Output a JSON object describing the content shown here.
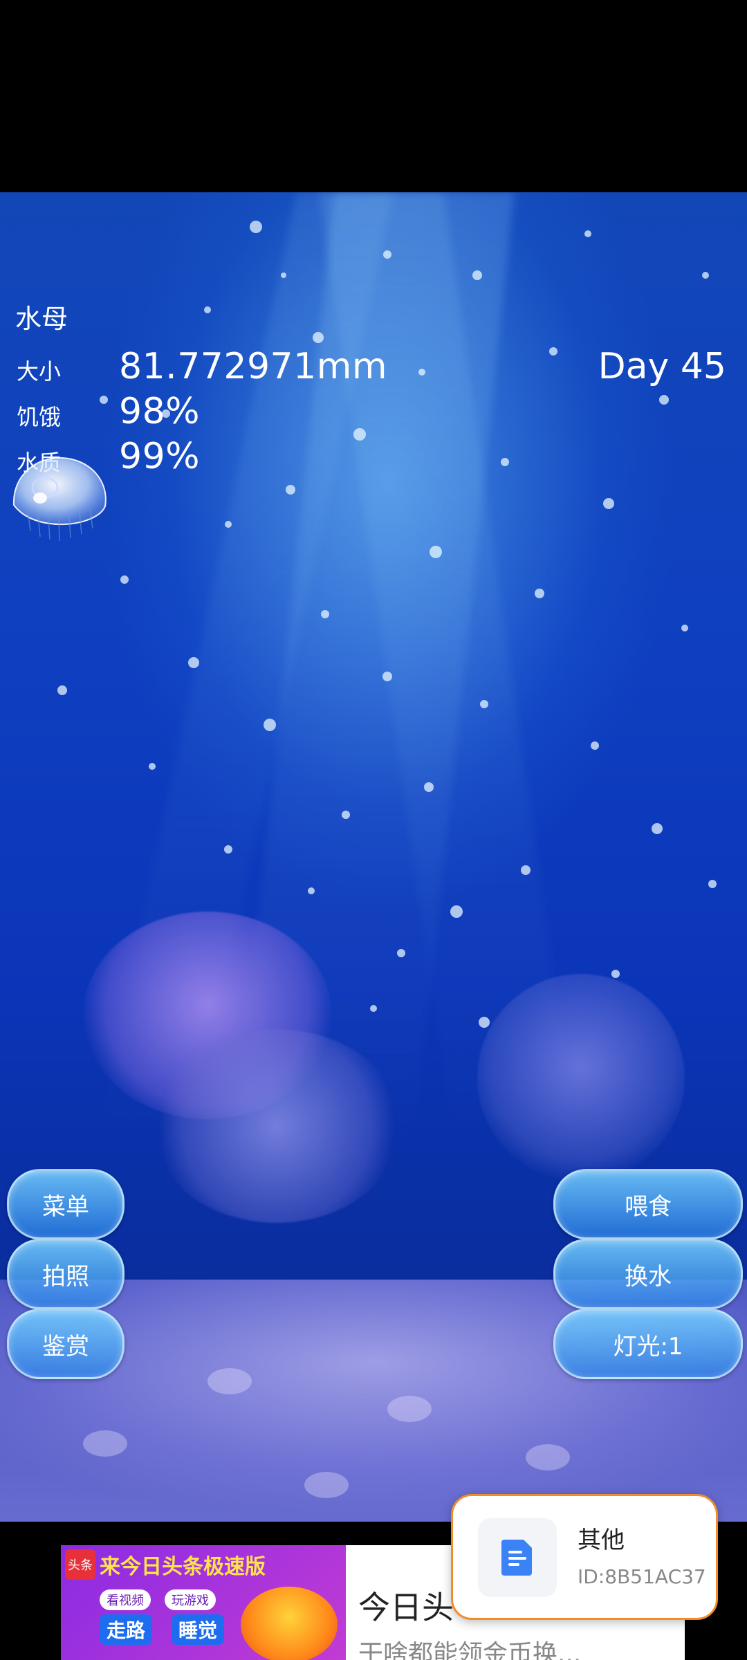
{
  "hud": {
    "title": "水母",
    "size_label": "大小",
    "size_value": "81.772971mm",
    "hunger_label": "饥饿",
    "hunger_value": "98%",
    "water_label": "水质",
    "water_value": "99%",
    "day": "Day 45"
  },
  "buttons_left": [
    "菜单",
    "拍照",
    "鉴赏"
  ],
  "buttons_right": [
    "喂食",
    "换水",
    "灯光:1"
  ],
  "ad": {
    "logo_text": "头条",
    "headline": "来今日头条极速版",
    "chip_1": "看视频",
    "chip_2": "玩游戏",
    "word_1": "走路",
    "word_2": "睡觉",
    "card_title": "今日头",
    "card_subtitle": "干啥都能领金币换..."
  },
  "toast": {
    "title": "其他",
    "id_text": "ID:8B51AC37",
    "accent": "#f08c2a",
    "icon_color": "#3b82f6"
  },
  "colors": {
    "water_top": "#1247b8",
    "water_bottom": "#07268a",
    "button_fill": "#4aa3ef"
  }
}
